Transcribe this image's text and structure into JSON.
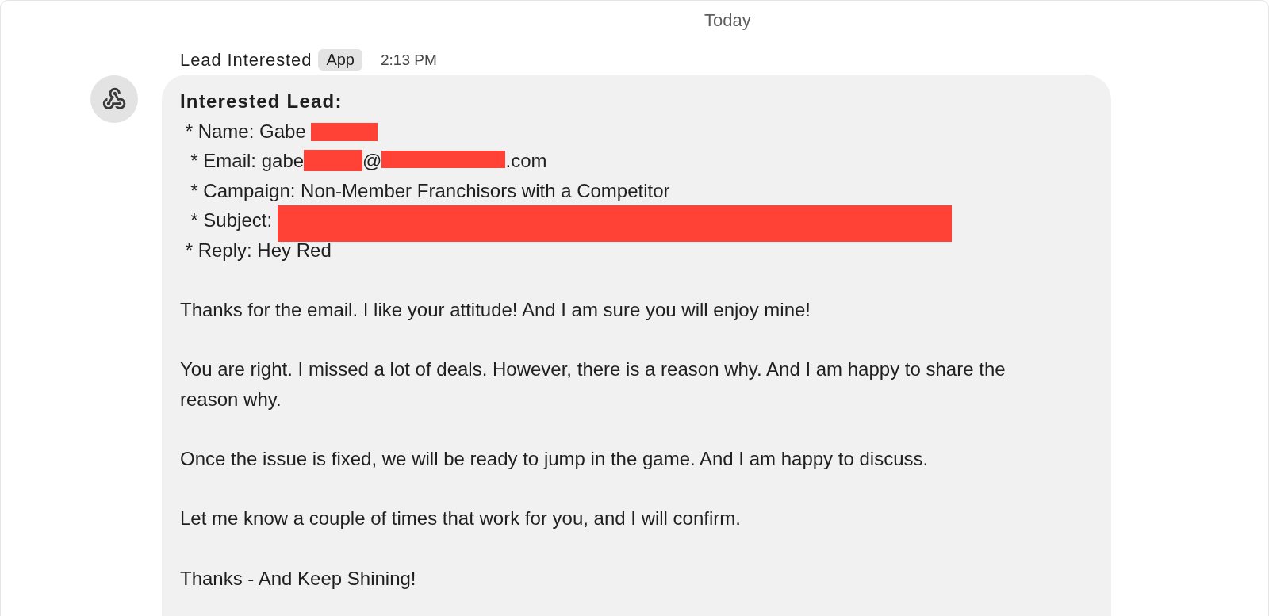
{
  "date_divider": {
    "label": "Today"
  },
  "message": {
    "sender": "Lead Interested",
    "badge": "App",
    "time": "2:13 PM",
    "title": "Interested Lead:",
    "fields": [
      {
        "segments": [
          {
            "kind": "text",
            "text": " * Name: Gabe"
          },
          {
            "kind": "redacted"
          }
        ]
      },
      {
        "segments": [
          {
            "kind": "text",
            "text": "  * Email: gabe"
          },
          {
            "kind": "redacted"
          },
          {
            "kind": "text",
            "text": "@"
          },
          {
            "kind": "redacted"
          },
          {
            "kind": "text",
            "text": ".com"
          }
        ]
      },
      {
        "segments": [
          {
            "kind": "text",
            "text": "  * Campaign: Non-Member Franchisors with a Competitor"
          }
        ]
      },
      {
        "segments": [
          {
            "kind": "text",
            "text": "  * Subject:"
          },
          {
            "kind": "redacted"
          }
        ]
      },
      {
        "segments": [
          {
            "kind": "text",
            "text": " * Reply: Hey Red"
          }
        ]
      }
    ],
    "paragraphs": [
      "Thanks for the email. I like your attitude! And I am sure you will enjoy mine!",
      "You are right. I missed a lot of deals. However, there is a reason why. And I am happy to share the reason why.",
      "Once the issue is fixed, we will be ready to jump in the game. And I am happy to discuss.",
      "Let me know a couple of times that work for you, and I will confirm.",
      "Thanks - And Keep Shining!"
    ]
  }
}
